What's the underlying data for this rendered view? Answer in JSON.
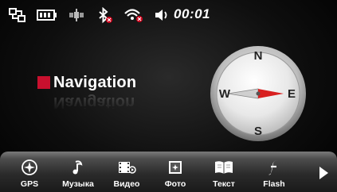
{
  "status_bar": {
    "time": "00:01",
    "icons": [
      "usb-connection-icon",
      "battery-icon",
      "gps-satellite-icon",
      "bluetooth-off-icon",
      "wifi-off-icon",
      "speaker-icon"
    ],
    "colors": {
      "off_indicator": "#d0021b",
      "icon": "#ffffff"
    }
  },
  "main": {
    "title": "Navigation",
    "accent": "#c8102e"
  },
  "compass": {
    "n": "N",
    "e": "E",
    "s": "S",
    "w": "W",
    "needle_color": "#d82020"
  },
  "toolbar": {
    "items": [
      {
        "label": "GPS",
        "icon": "gps-crosshair-icon"
      },
      {
        "label": "Музыка",
        "icon": "music-note-icon"
      },
      {
        "label": "Видео",
        "icon": "film-icon"
      },
      {
        "label": "Фото",
        "icon": "photo-icon"
      },
      {
        "label": "Текст",
        "icon": "book-icon"
      },
      {
        "label": "Flash",
        "icon": "flash-icon"
      }
    ],
    "next_icon": "arrow-right-icon"
  }
}
